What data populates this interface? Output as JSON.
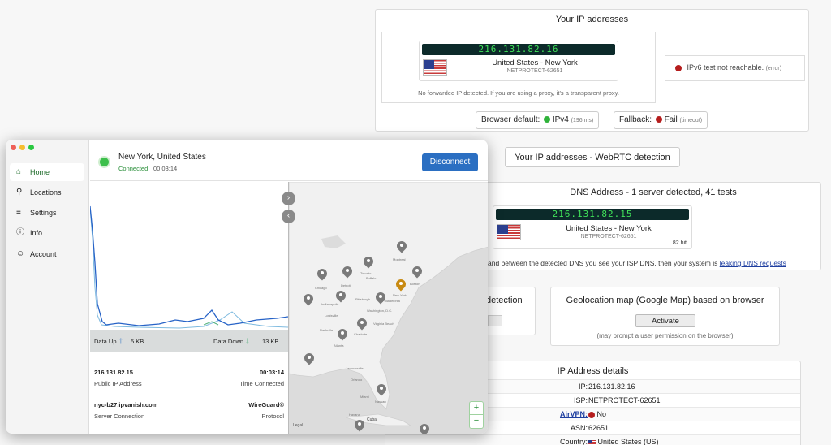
{
  "ip_panel": {
    "title": "Your IP addresses",
    "ip": "216.131.82.16",
    "location": "United States - New York",
    "isp": "NETPROTECT-62651",
    "no_forward": "No forwarded IP detected. If you are using a proxy, it's a transparent proxy.",
    "ipv6_text": "IPv6 test not reachable.",
    "ipv6_note": "(error)",
    "browser_default_label": "Browser default:",
    "browser_default_value": "IPv4",
    "browser_default_time": "(196 ms)",
    "fallback_label": "Fallback:",
    "fallback_value": "Fail",
    "fallback_note": "(timeout)"
  },
  "webrtc": {
    "label": "Your IP addresses - WebRTC detection"
  },
  "dns": {
    "title": "DNS Address - 1 server detected, 41 tests",
    "ip": "216.131.82.15",
    "location": "United States - New York",
    "isp": "NETPROTECT-62651",
    "hits": "82 hit",
    "note_text": "and between the detected DNS you see your ISP DNS, then your system is",
    "note_link": "leaking DNS requests"
  },
  "detection_partial": {
    "title": "detection"
  },
  "geolocation": {
    "title": "Geolocation map (Google Map) based on browser",
    "button": "Activate",
    "note": "(may prompt a user permission on the browser)"
  },
  "ip_details": {
    "title": "IP Address details",
    "rows": [
      {
        "key": "IP:",
        "value": "216.131.82.16"
      },
      {
        "key": "ISP:",
        "value": "NETPROTECT-62651"
      },
      {
        "key": "AirVPN:",
        "value": "No"
      },
      {
        "key": "ASN:",
        "value": "62651"
      },
      {
        "key": "Country:",
        "value": "United States (US)"
      }
    ]
  },
  "vpn_app": {
    "nav": [
      {
        "label": "Home",
        "icon": "home-icon"
      },
      {
        "label": "Locations",
        "icon": "pin-icon"
      },
      {
        "label": "Settings",
        "icon": "sliders-icon"
      },
      {
        "label": "Info",
        "icon": "info-icon"
      },
      {
        "label": "Account",
        "icon": "person-icon"
      }
    ],
    "location": "New York, United States",
    "status": "Connected",
    "timer": "00:03:14",
    "disconnect": "Disconnect",
    "data_up_label": "Data Up",
    "data_up_value": "5 KB",
    "data_down_label": "Data Down",
    "data_down_value": "13 KB",
    "public_ip": "216.131.82.15",
    "public_ip_label": "Public IP Address",
    "time_connected": "00:03:14",
    "time_connected_label": "Time Connected",
    "server": "nyc-b27.ipvanish.com",
    "server_label": "Server Connection",
    "protocol": "WireGuard®",
    "protocol_label": "Protocol",
    "map_zoom_in": "+",
    "map_zoom_out": "−",
    "legal": "Legal",
    "map_labels": [
      "Montreal",
      "Boston",
      "New York",
      "Chicago",
      "Detroit",
      "Toronto",
      "Buffalo",
      "Pittsburgh",
      "Philadelphia",
      "Washington, D.C.",
      "Indianapolis",
      "Louisville",
      "Nashville",
      "Atlanta",
      "Charlotte",
      "Virginia Beach",
      "Jacksonville",
      "Orlando",
      "Miami",
      "Havana",
      "Cuba",
      "Nassau"
    ],
    "colors": {
      "accent": "#2b6fc2",
      "connected": "#2a8f3a",
      "active_pin": "#c88a12"
    }
  }
}
